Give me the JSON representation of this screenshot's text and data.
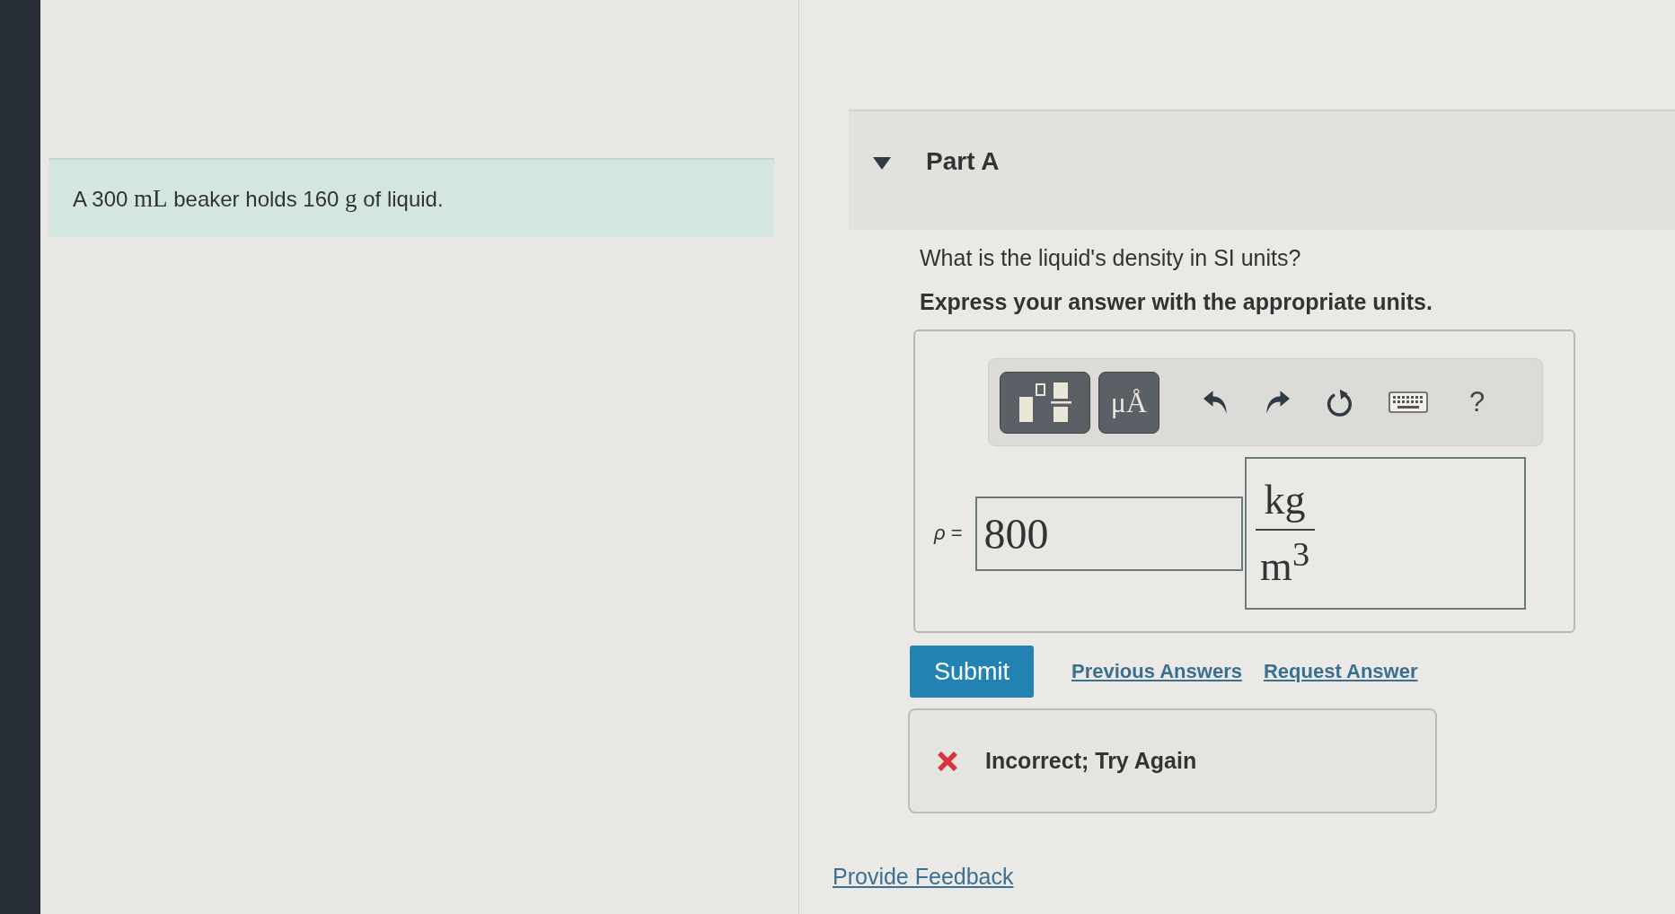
{
  "problem": {
    "statement": [
      {
        "kind": "text",
        "text": "A 300 "
      },
      {
        "kind": "unit",
        "text": "mL"
      },
      {
        "kind": "text",
        "text": " beaker holds 160 "
      },
      {
        "kind": "unit",
        "text": "g"
      },
      {
        "kind": "text",
        "text": " of liquid."
      }
    ]
  },
  "part": {
    "title": "Part A",
    "expanded": true,
    "question": "What is the liquid's density in SI units?",
    "instruction": "Express your answer with the appropriate units.",
    "toolbar": [
      {
        "kind": "templates"
      },
      {
        "kind": "symbols",
        "label": "μÅ"
      },
      {
        "kind": "undo"
      },
      {
        "kind": "redo"
      },
      {
        "kind": "reset"
      },
      {
        "kind": "keyboard"
      },
      {
        "kind": "help",
        "label": "?"
      }
    ],
    "answer": {
      "variable": "*ρ* =",
      "value": "800",
      "unit_numerator": "kg",
      "unit_denominator": "m$^{3}$"
    },
    "submit": "Submit",
    "links": [
      "Previous Answers",
      "Request Answer"
    ],
    "feedback": {
      "kind": "incorrect",
      "text": "Incorrect; Try Again"
    }
  },
  "provide_feedback": "Provide Feedback"
}
